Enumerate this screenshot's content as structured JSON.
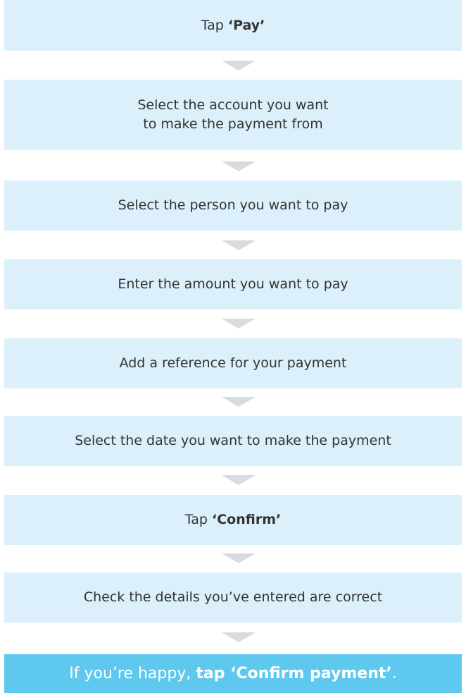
{
  "steps": [
    {
      "prefix": "Tap ",
      "bold": "‘Pay’",
      "suffix": ""
    },
    {
      "line1": "Select the account you want",
      "line2": "to make the payment from"
    },
    {
      "text": "Select the person you want to pay"
    },
    {
      "text": "Enter the amount you want to pay"
    },
    {
      "text": "Add a reference for your payment"
    },
    {
      "text": "Select the date you want to make the payment"
    },
    {
      "prefix": "Tap ",
      "bold": "‘Confirm’",
      "suffix": ""
    },
    {
      "text": "Check the details you’ve entered are correct"
    }
  ],
  "final": {
    "prefix": "If you’re happy, ",
    "bold": "tap ‘Confirm payment’",
    "suffix": "."
  },
  "colors": {
    "step_background": "#dcf0fb",
    "final_background": "#5ec8ee",
    "arrow": "#d8dbe0"
  }
}
